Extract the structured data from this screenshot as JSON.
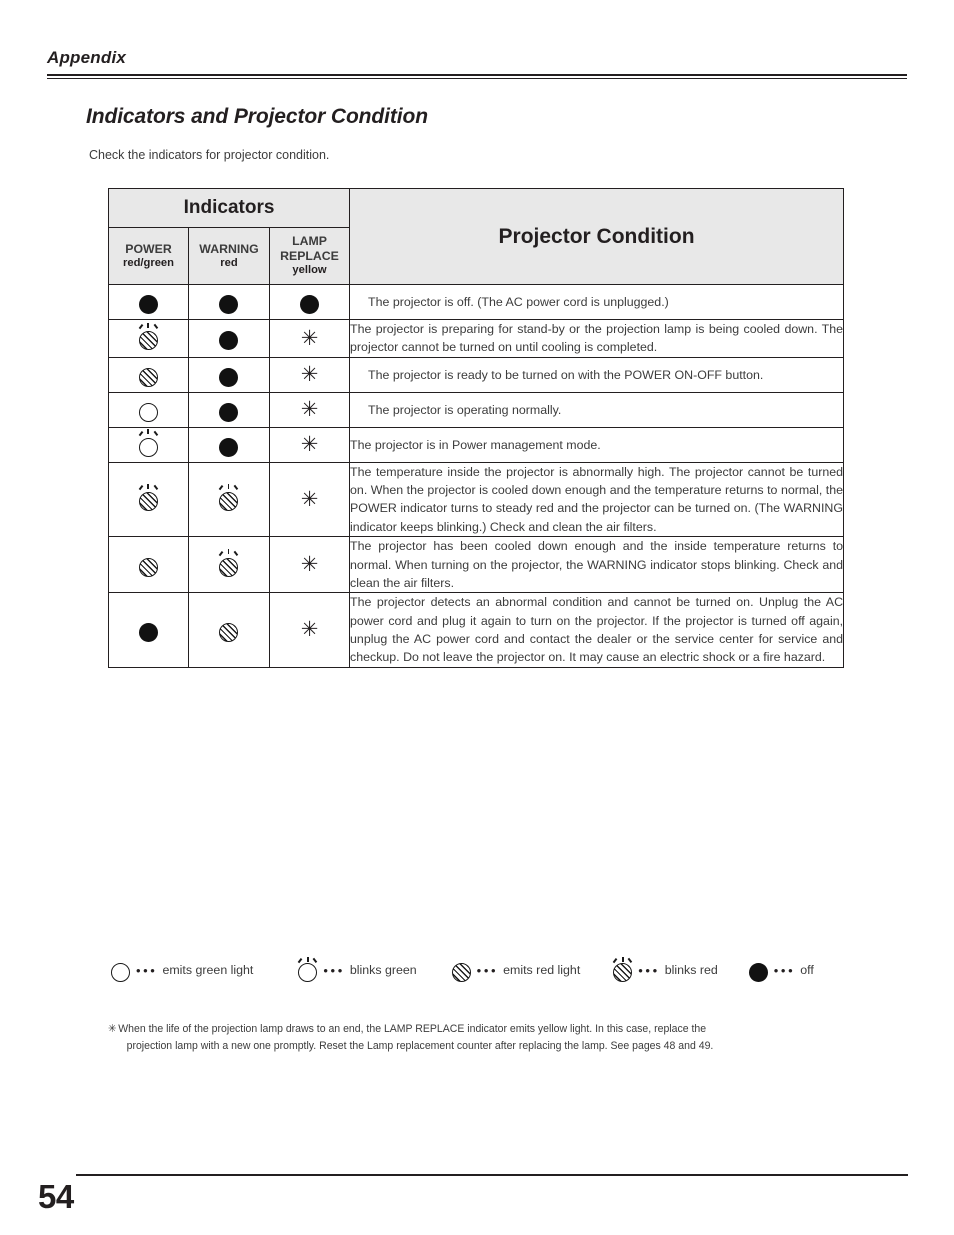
{
  "running_head": "Appendix",
  "section": {
    "title": "Indicators and Projector Condition",
    "intro": "Check the indicators for projector condition."
  },
  "table": {
    "group_header": "Indicators",
    "condition_header": "Projector Condition",
    "columns": [
      {
        "name": "POWER",
        "color": "red/green"
      },
      {
        "name": "WARNING",
        "color": "red"
      },
      {
        "name": "LAMP REPLACE",
        "name_line1": "LAMP",
        "name_line2": "REPLACE",
        "color": "yellow"
      }
    ],
    "rows": [
      {
        "power": "off",
        "warning": "off",
        "lamp": "off",
        "condition": "The projector is off. (The AC power cord is unplugged.)",
        "justify": false,
        "indent": true
      },
      {
        "power": "blinks-red",
        "warning": "off",
        "lamp": "asterisk",
        "condition": "The projector is preparing for stand-by or the projection lamp is being cooled down. The projector cannot be turned on until cooling is completed.",
        "justify": true,
        "indent": false
      },
      {
        "power": "emits-red",
        "warning": "off",
        "lamp": "asterisk",
        "condition": "The projector is ready to be turned on with the POWER ON-OFF button.",
        "justify": false,
        "indent": true
      },
      {
        "power": "emits-green",
        "warning": "off",
        "lamp": "asterisk",
        "condition": "The projector is operating normally.",
        "justify": false,
        "indent": true
      },
      {
        "power": "blinks-green",
        "warning": "off",
        "lamp": "asterisk",
        "condition": "The projector is in Power management mode.",
        "justify": false,
        "indent": false
      },
      {
        "power": "blinks-red",
        "warning": "blinks-red",
        "lamp": "asterisk",
        "condition": "The temperature inside the projector is abnormally high. The projector cannot be turned on. When the projector is cooled down enough and the temperature returns to normal, the POWER indicator turns to steady red and the projector can be turned on. (The WARNING indicator keeps blinking.) Check and clean the air filters.",
        "justify": true,
        "indent": false
      },
      {
        "power": "emits-red",
        "warning": "blinks-red",
        "lamp": "asterisk",
        "condition": "The projector has been cooled down enough and the inside temperature returns to normal. When turning on the projector, the WARNING indicator stops blinking. Check and clean the air filters.",
        "justify": true,
        "indent": false
      },
      {
        "power": "off",
        "warning": "emits-red",
        "lamp": "asterisk",
        "condition": "The projector detects an abnormal condition and cannot be turned on. Unplug the AC power cord and plug it again to turn on the projector. If the projector is turned off again, unplug the AC power cord and contact the dealer or the service center for service and checkup. Do not leave the projector on. It may cause an electric shock or a fire hazard.",
        "justify": true,
        "indent": false
      }
    ]
  },
  "legend": {
    "dots": "•••",
    "items": [
      {
        "symbol": "emits-green",
        "label": "emits green light"
      },
      {
        "symbol": "blinks-green",
        "label": "blinks green"
      },
      {
        "symbol": "emits-red",
        "label": "emits red light"
      },
      {
        "symbol": "blinks-red",
        "label": "blinks red"
      },
      {
        "symbol": "off",
        "label": "off"
      }
    ]
  },
  "footnote": {
    "mark": "✳",
    "line1": "When the life of the projection lamp draws to an end, the LAMP REPLACE indicator emits yellow light. In this case, replace the",
    "line2": "projection lamp with a new one promptly. Reset the Lamp replacement counter after replacing the lamp. See pages 48 and 49."
  },
  "folio": {
    "page_number": "54"
  }
}
